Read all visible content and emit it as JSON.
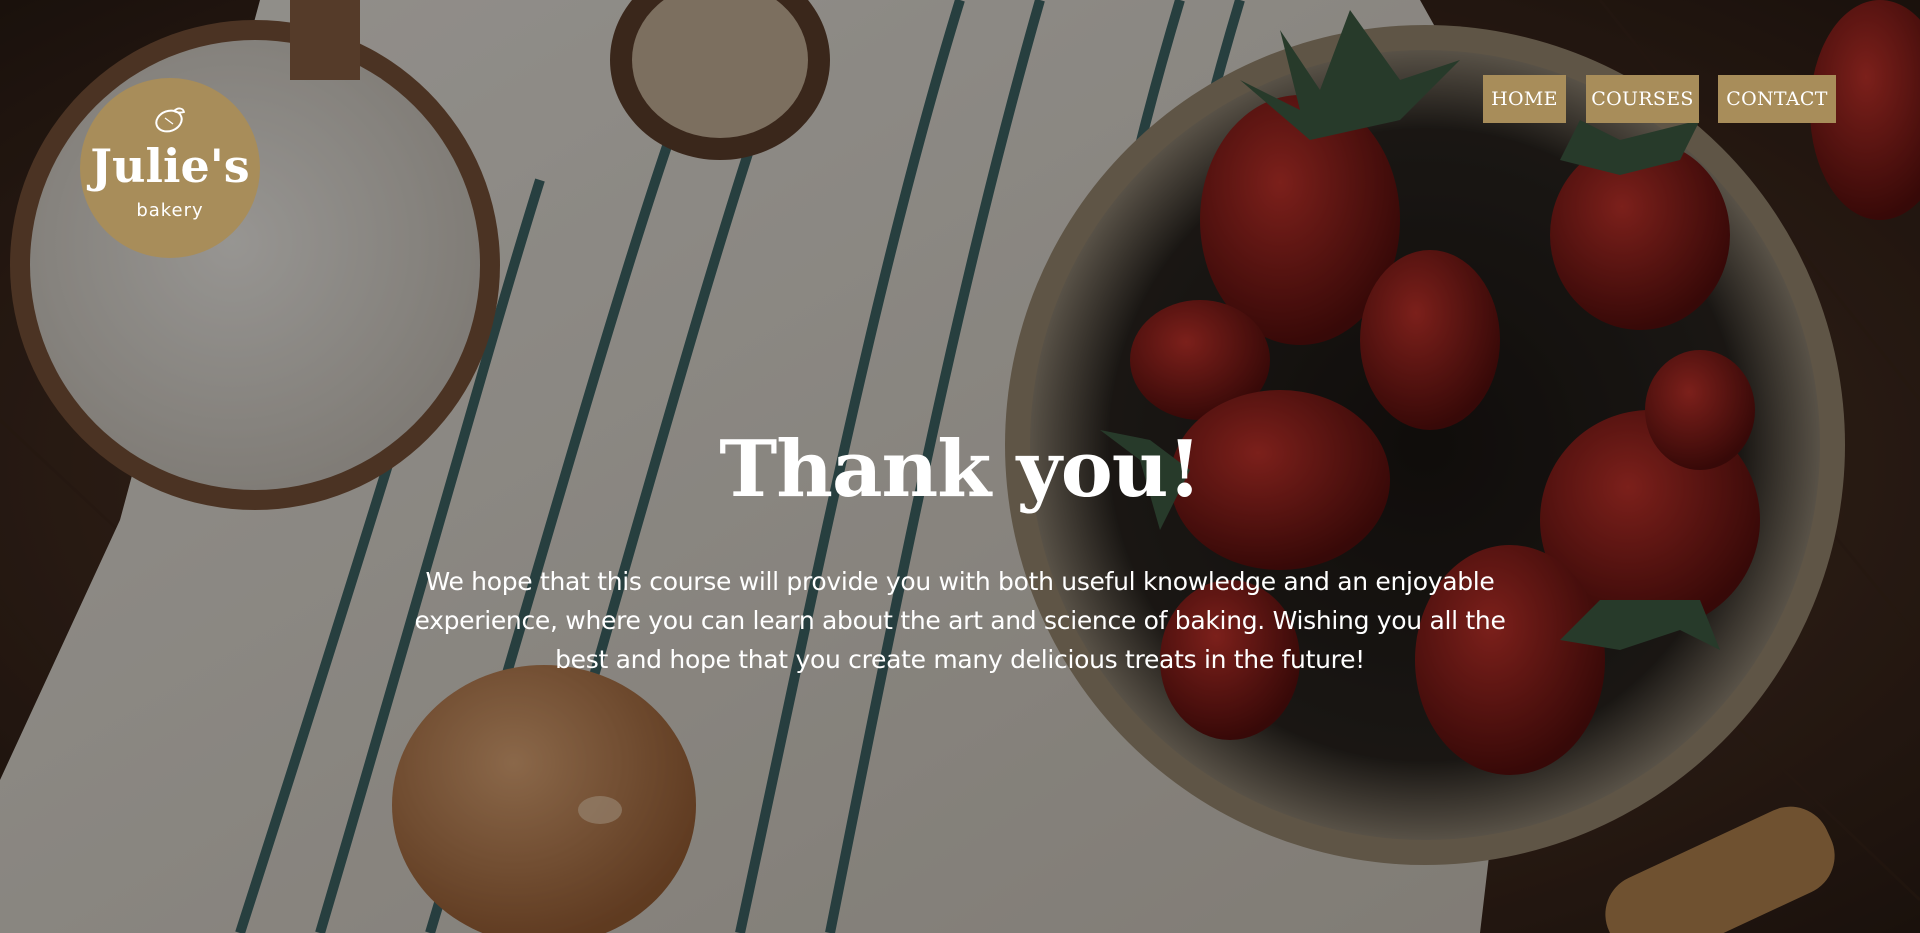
{
  "brand": {
    "name": "Julie's",
    "subtitle": "bakery",
    "accent_color": "#a88d5a"
  },
  "nav": {
    "items": [
      {
        "label": "HOME"
      },
      {
        "label": "COURSES"
      },
      {
        "label": "CONTACT"
      }
    ]
  },
  "hero": {
    "title": "Thank you!",
    "text": "We hope that this course will provide you with both useful knowledge and an enjoyable experience, where you can learn about the art and science of baking. Wishing you all the best and hope that you create many delicious treats in the future!"
  },
  "icons": {
    "logo_icon": "lemon-icon"
  }
}
